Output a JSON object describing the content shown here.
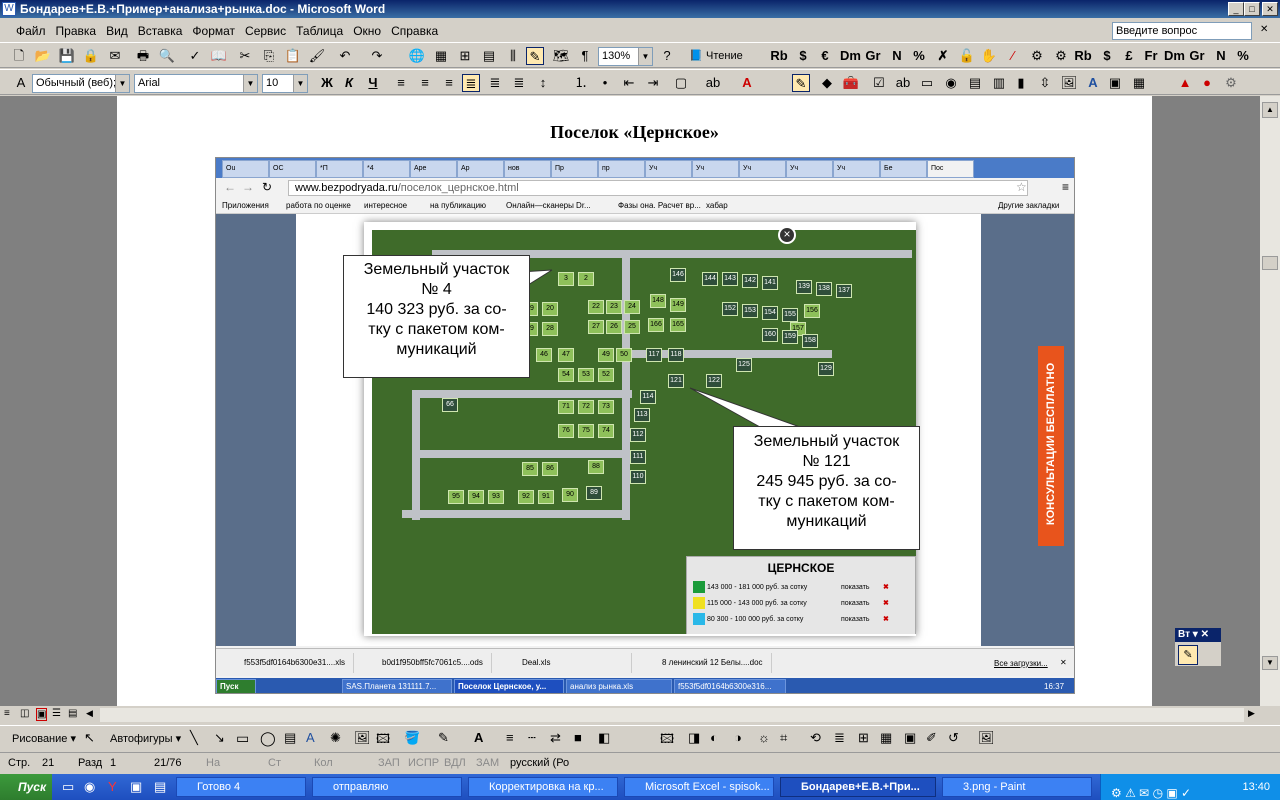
{
  "window": {
    "title": "Бондарев+Е.В.+Пример+анализа+рынка.doc - Microsoft Word"
  },
  "menu": [
    "Файл",
    "Правка",
    "Вид",
    "Вставка",
    "Формат",
    "Сервис",
    "Таблица",
    "Окно",
    "Справка"
  ],
  "ask_placeholder": "Введите вопрос",
  "toolbar": {
    "zoom": "130%",
    "reading": "Чтение",
    "style": "Обычный (веб);",
    "font": "Arial",
    "size": "10"
  },
  "document": {
    "title": "Поселок «Цернское»"
  },
  "browser": {
    "url_host": "www.bezpodryada.ru",
    "url_path": "/поселок_цернское.html",
    "tabs": [
      "Ou",
      "ОС",
      "*П",
      "*4",
      "Аре",
      "Ар",
      "нов",
      "Пр",
      "пр",
      "Уч",
      "Уч",
      "Уч",
      "Уч",
      "Уч",
      "Бе",
      "Пос"
    ],
    "bookmarks": [
      "Приложения",
      "работа по оценке",
      "интересное",
      "на публикацию",
      "Онлайн—сканеры Dr...",
      "Фазы она. Расчет вр...",
      "хабар",
      "Другие закладки"
    ],
    "consult": "КОНСУЛЬТАЦИИ БЕСПЛАТНО",
    "downloads": [
      "f553f5df0164b6300e31....xls",
      "b0d1f950bff5fc7061c5....ods",
      "Deal.xls",
      "8 ленинский 12 Белы....doc"
    ],
    "all_downloads": "Все загрузки...",
    "inner_taskbar": [
      "Пуск",
      "SAS.Планета 131111.7...",
      "Поселок Цернское, у...",
      "анализ рынка.xls",
      "f553f5df0164b6300e316..."
    ],
    "inner_clock": "16:37"
  },
  "map": {
    "legend_title": "ЦЕРНСКОЕ",
    "legend": [
      {
        "color": "#1a9b3a",
        "range": "143 000 - 181 000 руб. за сотку",
        "action": "показать"
      },
      {
        "color": "#f0e020",
        "range": "115 000 - 143 000 руб. за сотку",
        "action": "показать"
      },
      {
        "color": "#2ab8e8",
        "range": "80 300 - 100 000 руб. за сотку",
        "action": "показать"
      }
    ],
    "plots_light": [
      "3",
      "2",
      "19",
      "20",
      "22",
      "23",
      "24",
      "29",
      "28",
      "27",
      "26",
      "25",
      "47",
      "49",
      "50",
      "54",
      "53",
      "52",
      "71",
      "72",
      "73",
      "76",
      "75",
      "74",
      "85",
      "86",
      "88",
      "95",
      "94",
      "93",
      "92",
      "91",
      "90",
      "46",
      "148",
      "149",
      "166",
      "165",
      "157",
      "156"
    ],
    "plots_dark": [
      "146",
      "144",
      "143",
      "142",
      "141",
      "139",
      "138",
      "137",
      "152",
      "153",
      "154",
      "155",
      "160",
      "159",
      "158",
      "125",
      "129",
      "117",
      "118",
      "121",
      "122",
      "114",
      "113",
      "112",
      "111",
      "110",
      "66",
      "89"
    ]
  },
  "callouts": [
    {
      "title": "Земельный участок",
      "number": "№ 4",
      "price": "140 323 руб. за со-",
      "price2": "тку с пакетом ком-",
      "price3": "муникаций"
    },
    {
      "title": "Земельный участок",
      "number": "№ 121",
      "price": "245 945 руб. за со-",
      "price2": "тку с пакетом ком-",
      "price3": "муникаций"
    }
  ],
  "mini_panel": "Вт",
  "drawing": {
    "draw": "Рисование",
    "autoshapes": "Автофигуры"
  },
  "status": {
    "page": "Стр.",
    "page_num": "21",
    "section": "Разд",
    "section_num": "1",
    "pages": "21/76",
    "at": "На",
    "line": "Ст",
    "col": "Кол",
    "rec": "ЗАП",
    "trk": "ИСПР",
    "ext": "ВДЛ",
    "ovr": "ЗАМ",
    "lang": "русский (Ро"
  },
  "taskbar": {
    "start": "Пуск",
    "tasks": [
      "Готово 4",
      "отправляю",
      "Корректировка на кр...",
      "Microsoft Excel - spisok...",
      "Бондарев+Е.В.+При...",
      "3.png - Paint"
    ],
    "clock": "13:40"
  }
}
